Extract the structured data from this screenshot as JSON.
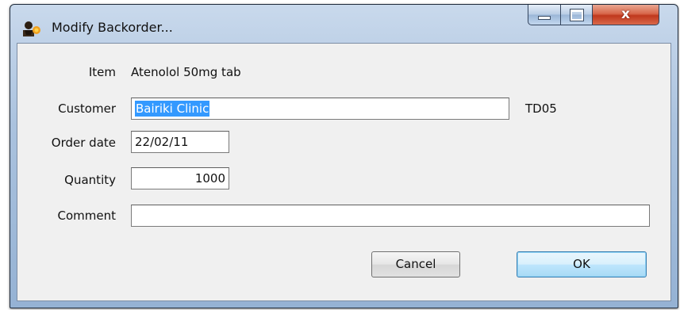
{
  "window": {
    "title": "Modify Backorder...",
    "close_glyph": "x",
    "icons": {
      "app": "backorder-app-icon",
      "minimize": "minimize-icon",
      "maximize": "maximize-icon",
      "close": "close-icon"
    }
  },
  "form": {
    "item_label": "Item",
    "item_value": "Atenolol 50mg tab",
    "customer_label": "Customer",
    "customer_value": "Bairiki Clinic",
    "customer_code": "TD05",
    "order_date_label": "Order date",
    "order_date_value": "22/02/11",
    "quantity_label": "Quantity",
    "quantity_value": "1000",
    "comment_label": "Comment",
    "comment_value": ""
  },
  "buttons": {
    "cancel_label": "Cancel",
    "ok_label": "OK"
  },
  "colors": {
    "selection": "#3399ff",
    "close_button": "#c0381d"
  }
}
